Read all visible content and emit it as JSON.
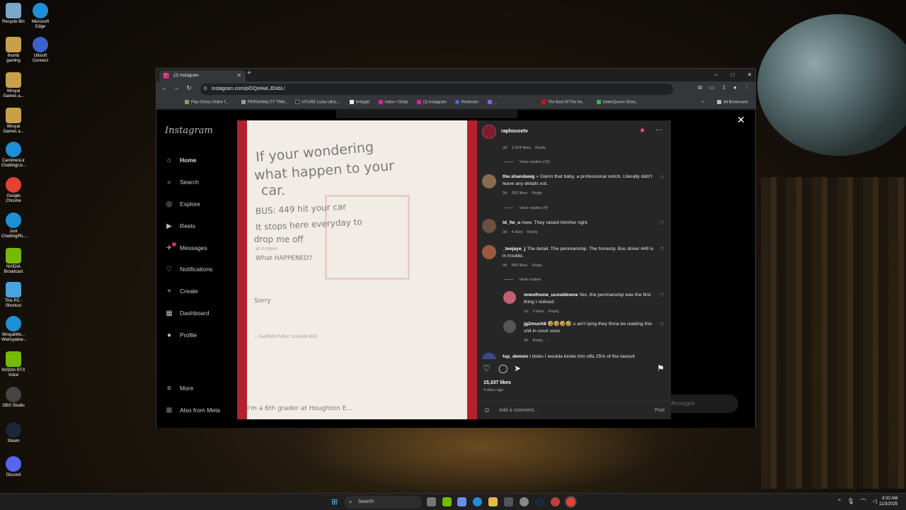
{
  "desktop": {
    "icons": [
      {
        "label": "Recycle Bin",
        "color": "#7aa7c7"
      },
      {
        "label": "Microsoft Edge",
        "color": "#1e8fd6"
      },
      {
        "label": "thumb gaming",
        "color": "#c9a04a"
      },
      {
        "label": "Ubisoft Connect",
        "color": "#3b62c8"
      },
      {
        "label": "Wroyal Games a...",
        "color": "#c9a04a"
      },
      {
        "label": "Wroyal Games a...",
        "color": "#c9a04a"
      },
      {
        "label": "CarolinesLir ChattingLiv...",
        "color": "#1e8fd6"
      },
      {
        "label": "Google Chrome",
        "color": "#e34133"
      },
      {
        "label": "Just ChattingIRL...",
        "color": "#1e8fd6"
      },
      {
        "label": "NVIDIA Broadcast",
        "color": "#76b900"
      },
      {
        "label": "This PC - Shortcut",
        "color": "#4aa3df"
      },
      {
        "label": "WroyalWo... Wwroyalow...",
        "color": "#1e8fd6"
      },
      {
        "label": "NVIDIA RTX Voice",
        "color": "#76b900"
      },
      {
        "label": "OBS Studio",
        "color": "#444444"
      },
      {
        "label": "Steam",
        "color": "#1b2838"
      },
      {
        "label": "Discord",
        "color": "#5865f2"
      }
    ]
  },
  "browser": {
    "tab_title": "(2) Instagram",
    "new_tab": "+",
    "url": "instagram.com/p/DQsHwLJDxbL/",
    "window_controls": [
      "–",
      "□",
      "✕"
    ],
    "bookmarks": [
      {
        "label": "Play Chess Online f...",
        "color": "#7fa650"
      },
      {
        "label": "PERSONALITY TRAI...",
        "color": "#999999"
      },
      {
        "label": "VITURE Luma Ultra...",
        "color": "#222222"
      },
      {
        "label": "fentygirl",
        "color": "#eeeeee"
      },
      {
        "label": "Inbox • Chats",
        "color": "#d6249f"
      },
      {
        "label": "(1) Instagram",
        "color": "#d6249f"
      },
      {
        "label": "Restream",
        "color": "#3c6ee8"
      },
      {
        "label": "...",
        "color": "#8a5cf6"
      },
      {
        "label": "The Best Of The Int...",
        "color": "#ff0000"
      },
      {
        "label": "DelenQueen Strea...",
        "color": "#3cb34a"
      }
    ],
    "all_bookmarks": "All Bookmarks"
  },
  "instagram": {
    "logo": "Instagram",
    "nav": [
      {
        "label": "Home",
        "icon": "⌂"
      },
      {
        "label": "Search",
        "icon": "⌕"
      },
      {
        "label": "Explore",
        "icon": "◎"
      },
      {
        "label": "Reels",
        "icon": "▶"
      },
      {
        "label": "Messages",
        "icon": "✈"
      },
      {
        "label": "Notifications",
        "icon": "♡"
      },
      {
        "label": "Create",
        "icon": "+"
      },
      {
        "label": "Dashboard",
        "icon": "▦"
      },
      {
        "label": "Profile",
        "icon": "●"
      }
    ],
    "more": "More",
    "also_from_meta": "Also from Meta",
    "messages_pill": "Messages",
    "close": "✕"
  },
  "post": {
    "username": "raphousetv",
    "note_lines": [
      "If your wondering",
      "what happen to your",
      "car.",
      "BUS: 449 hit your car",
      "It stops here everyday to",
      "drop me off",
      "at 3:00pm",
      "What HAPPENED?",
      "Sorry",
      "~ Fairfield Public Schools BUS",
      "I'm a 6th grader at Houghton E..."
    ],
    "comments": [
      {
        "user": "",
        "text": "",
        "time": "3d",
        "likes": "1,424 likes",
        "reply": "Reply"
      },
      {
        "user": "the.shandawg",
        "text": "Damn that baby, a professional snitch. Literally didn't leave any details out.",
        "time": "3d",
        "likes": "282 likes",
        "reply": "Reply"
      },
      {
        "user": "ld_fw_u",
        "text": "Aww. They raised him/her right.",
        "time": "3d",
        "likes": "4 likes",
        "reply": "Reply"
      },
      {
        "user": "_teejaye_j",
        "text": "The detail. The penmanship. The honesty. Bus driver 449 is in trouble.",
        "time": "4d",
        "likes": "959 likes",
        "reply": "Reply"
      },
      {
        "user": "oneofnone_ucouldneva",
        "text": "Yes, the penmanship was the first thing I noticed.",
        "time": "1d",
        "likes": "2 likes",
        "reply": "Reply"
      },
      {
        "user": "jg2much8",
        "text": "🤣🤣🤣🤣 u ain't lying they finna be reading this shit in court soon",
        "time": "3h",
        "likes": "",
        "reply": "Reply"
      },
      {
        "user": "tsp_demon",
        "text": "I listen I woulda broke him offa 25% of the lawsuit",
        "time": "",
        "likes": "",
        "reply": ""
      }
    ],
    "view_replies": [
      "View replies (10)",
      "View replies (4)",
      "Hide replies"
    ],
    "likes": "15,337 likes",
    "ago": "4 days ago",
    "add_comment_placeholder": "Add a comment...",
    "post_button": "Post"
  },
  "taskbar": {
    "search": "Search",
    "time": "6:32 AM",
    "date": "11/3/2025"
  }
}
